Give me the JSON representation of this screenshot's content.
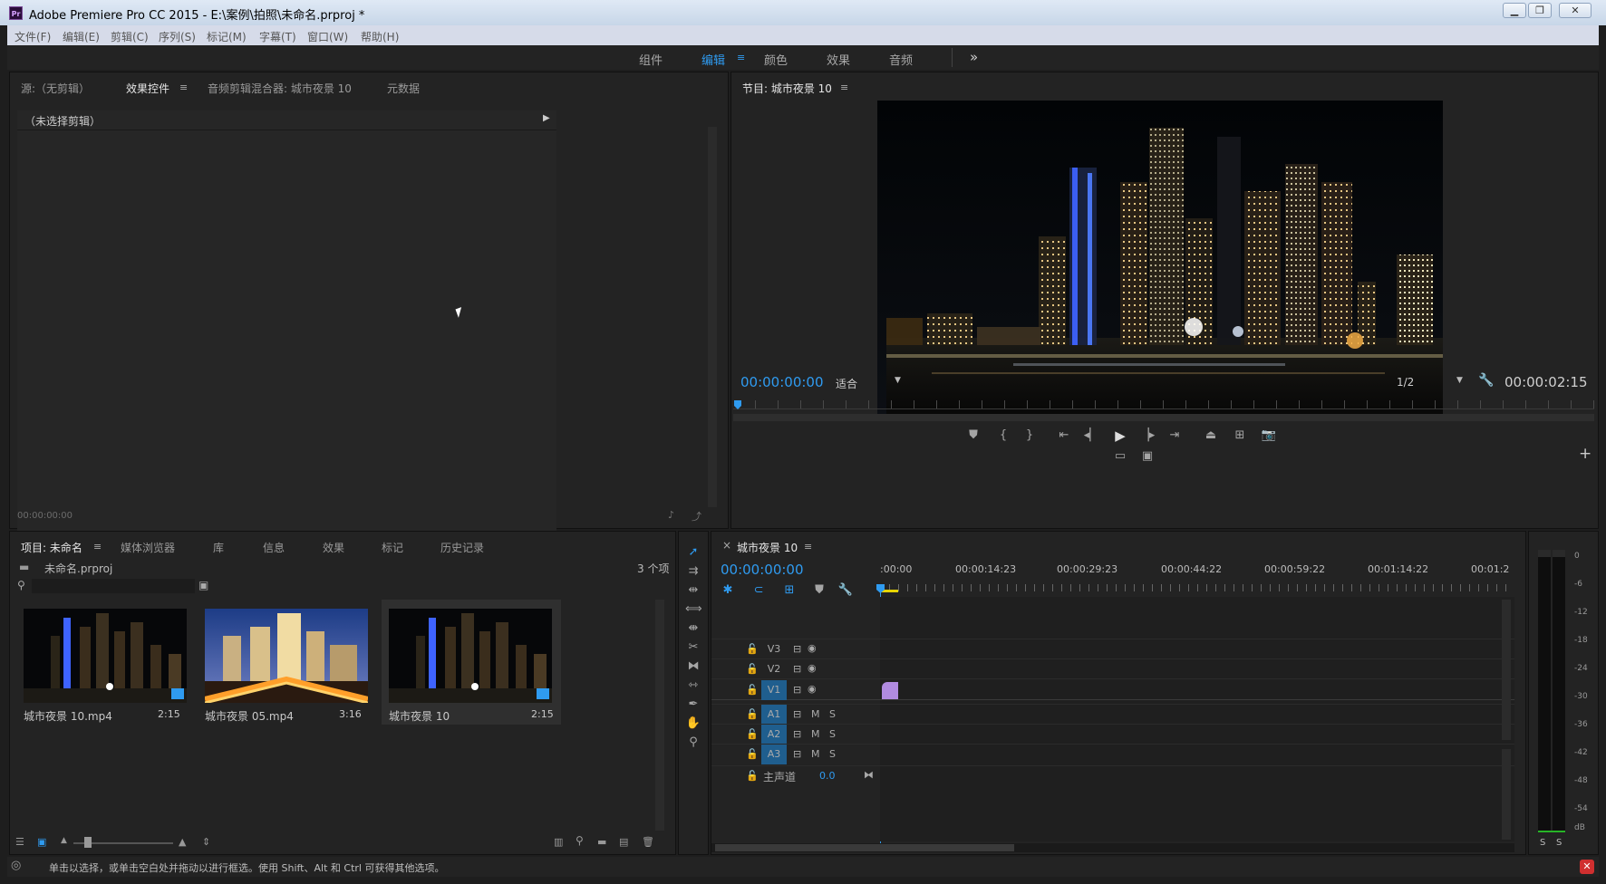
{
  "titlebar": {
    "app_icon": "Pr",
    "title": "Adobe Premiere Pro CC 2015 - E:\\案例\\拍照\\未命名.prproj *",
    "minimize": "minimize-icon",
    "restore": "restore-icon",
    "close": "close-icon"
  },
  "menubar": [
    "文件(F)",
    "编辑(E)",
    "剪辑(C)",
    "序列(S)",
    "标记(M)",
    "字幕(T)",
    "窗口(W)",
    "帮助(H)"
  ],
  "workspaces": {
    "items": [
      "组件",
      "编辑",
      "颜色",
      "效果",
      "音频"
    ],
    "active": "编辑",
    "more": "»"
  },
  "source_panel": {
    "tabs": [
      "源:（无剪辑）",
      "效果控件",
      "音频剪辑混合器: 城市夜景 10",
      "元数据"
    ],
    "active_tab": "效果控件",
    "no_clip_label": "（未选择剪辑）",
    "timecode": "00:00:00:00"
  },
  "program_monitor": {
    "tab": "节目: 城市夜景 10",
    "timecode_current": "00:00:00:00",
    "fit_label": "适合",
    "resolution": "1/2",
    "timecode_duration": "00:00:02:15",
    "add_button": "+"
  },
  "project_panel": {
    "tabs": [
      "项目: 未命名",
      "媒体浏览器",
      "库",
      "信息",
      "效果",
      "标记",
      "历史记录"
    ],
    "active_tab": "项目: 未命名",
    "project_file": "未命名.prproj",
    "item_count": "3 个项",
    "items": [
      {
        "name": "城市夜景 10.mp4",
        "duration": "2:15"
      },
      {
        "name": "城市夜景 05.mp4",
        "duration": "3:16"
      },
      {
        "name": "城市夜景 10",
        "duration": "2:15"
      }
    ]
  },
  "timeline": {
    "tab": "城市夜景 10",
    "close": "×",
    "timecode": "00:00:00:00",
    "ruler": [
      ":00:00",
      "00:00:14:23",
      "00:00:29:23",
      "00:00:44:22",
      "00:00:59:22",
      "00:01:14:22",
      "00:01:2"
    ],
    "video_tracks": [
      "V3",
      "V2",
      "V1"
    ],
    "audio_tracks": [
      "A1",
      "A2",
      "A3"
    ],
    "mute": "M",
    "solo": "S",
    "master_label": "主声道",
    "master_value": "0.0"
  },
  "audio_meter": {
    "scale": [
      "0",
      "-6",
      "-12",
      "-18",
      "-24",
      "-30",
      "-36",
      "-42",
      "-48",
      "-54",
      "dB"
    ],
    "solo_left": "S",
    "solo_right": "S"
  },
  "statusbar": {
    "text": "单击以选择，或单击空白处并拖动以进行框选。使用 Shift、Alt 和 Ctrl 可获得其他选项。"
  },
  "colors": {
    "accent": "#2f9bf0",
    "track_selected": "#1f5e8e",
    "clip": "#b18be0",
    "playhead": "#2f9bf0"
  }
}
